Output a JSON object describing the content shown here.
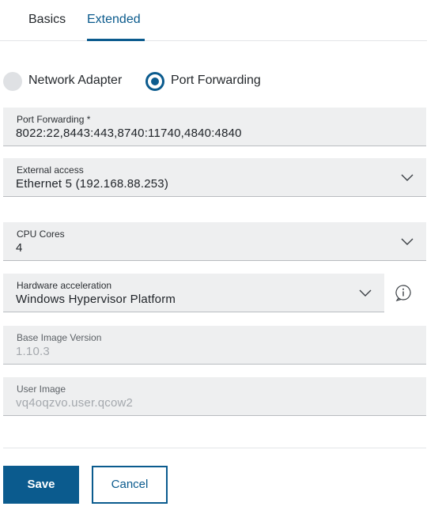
{
  "tabs": [
    {
      "label": "Basics",
      "active": false
    },
    {
      "label": "Extended",
      "active": true
    }
  ],
  "mode": {
    "options": [
      {
        "label": "Network Adapter",
        "selected": false
      },
      {
        "label": "Port Forwarding",
        "selected": true
      }
    ]
  },
  "fields": {
    "port_forwarding": {
      "label": "Port Forwarding *",
      "value": "8022:22,8443:443,8740:11740,4840:4840"
    },
    "external_access": {
      "label": "External access",
      "value": "Ethernet 5 (192.168.88.253)"
    },
    "cpu_cores": {
      "label": "CPU Cores",
      "value": "4"
    },
    "hardware_acceleration": {
      "label": "Hardware acceleration",
      "value": "Windows Hypervisor Platform"
    },
    "base_image_version": {
      "label": "Base Image Version",
      "value": "1.10.3",
      "disabled": true
    },
    "user_image": {
      "label": "User Image",
      "value": "vq4oqzvo.user.qcow2",
      "disabled": true
    }
  },
  "actions": {
    "save_label": "Save",
    "cancel_label": "Cancel"
  },
  "icons": {
    "dropdown": "chevron-down-icon",
    "info": "info-icon"
  },
  "colors": {
    "accent": "#0b5b8e",
    "field_bg": "#eeeff0",
    "disabled_text": "#a4a8ad"
  }
}
